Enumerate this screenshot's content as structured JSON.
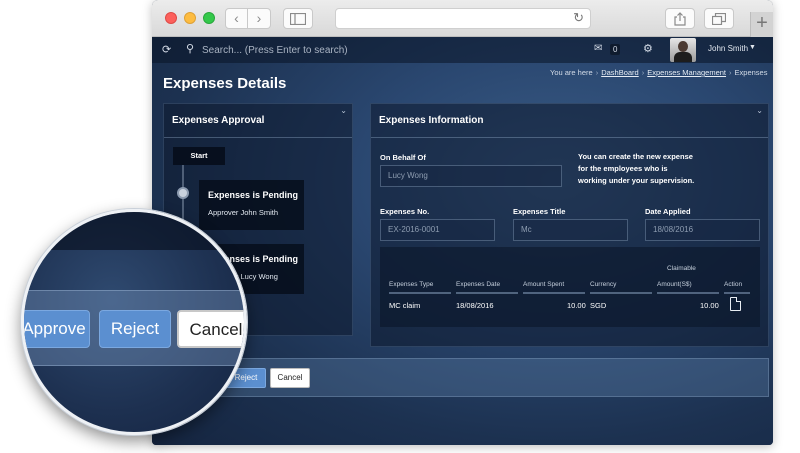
{
  "browser": {
    "back_glyph": "‹",
    "forward_glyph": "›",
    "reload_glyph": "↻",
    "newtab_glyph": "+"
  },
  "topbar": {
    "search_placeholder": "Search... (Press Enter to search)",
    "mail_count": "0",
    "user_name": "John Smith"
  },
  "page": {
    "title": "Expenses Details",
    "breadcrumb": {
      "prefix": "You are here",
      "items": [
        "DashBoard",
        "Expenses Management",
        "Expenses"
      ]
    }
  },
  "approval": {
    "title": "Expenses Approval",
    "start_label": "Start",
    "steps": [
      {
        "title": "Expenses is Pending",
        "subtitle": "Approver John Smith"
      },
      {
        "title": "Expenses is Pending",
        "subtitle": "Approver Lucy Wong"
      }
    ]
  },
  "info": {
    "title": "Expenses Information",
    "on_behalf_label": "On Behalf Of",
    "on_behalf_value": "Lucy Wong",
    "hint": "You can create the new expense for the employees who is working under your supervision.",
    "expenses_no_label": "Expenses No.",
    "expenses_no_value": "EX-2016-0001",
    "expenses_title_label": "Expenses Title",
    "expenses_title_value": "Mc",
    "date_applied_label": "Date Applied",
    "date_applied_value": "18/08/2016",
    "table": {
      "claimable_header_top": "Claimable",
      "columns": [
        "Expenses Type",
        "Expenses Date",
        "Amount Spent",
        "Currency",
        "Amount(S$)",
        "Action"
      ],
      "rows": [
        {
          "type": "MC claim",
          "date": "18/08/2016",
          "amount_spent": "10.00",
          "currency": "SGD",
          "claimable": "10.00"
        }
      ]
    }
  },
  "footer": {
    "reject_label": "Reject",
    "cancel_label": "Cancel"
  },
  "magnifier": {
    "approve_label": "Approve",
    "reject_label": "Reject",
    "cancel_label": "Cancel"
  },
  "colors": {
    "primary_button": "#5b8fd0",
    "background_dark": "#1c3150"
  }
}
